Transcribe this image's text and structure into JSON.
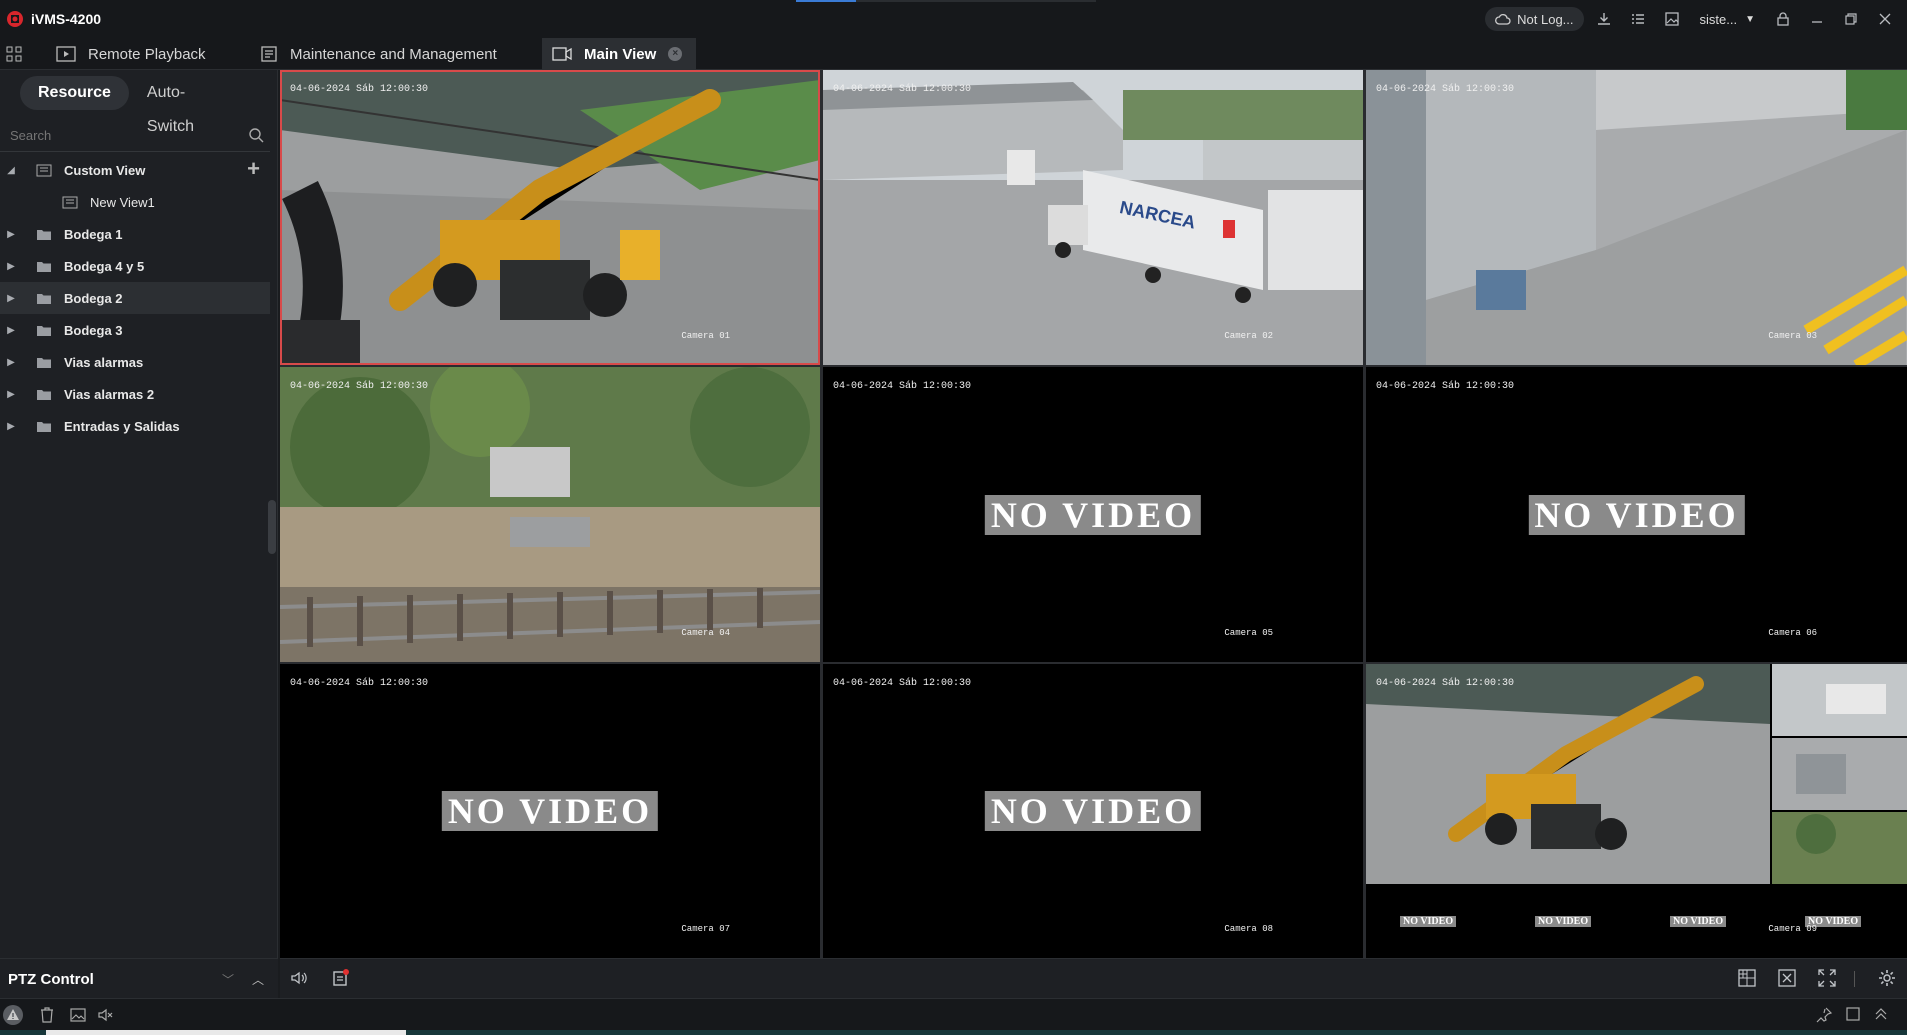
{
  "app": {
    "title": "iVMS-4200",
    "brand_color": "#d8262c"
  },
  "titlebar": {
    "cloud_status": "Not Log...",
    "user": "siste..."
  },
  "tabs": [
    {
      "label": "Remote Playback",
      "icon": "playback-icon"
    },
    {
      "label": "Maintenance and Management",
      "icon": "maintenance-icon"
    },
    {
      "label": "Main View",
      "icon": "main-view-icon",
      "active": true
    }
  ],
  "sidebar": {
    "segments": [
      "Resource",
      "Auto-Switch"
    ],
    "search_placeholder": "Search",
    "tree": [
      {
        "label": "Custom View",
        "expanded": true
      },
      {
        "label": "New View1",
        "child": true
      },
      {
        "label": "Bodega 1"
      },
      {
        "label": "Bodega 4 y 5"
      },
      {
        "label": "Bodega 2",
        "selected": true
      },
      {
        "label": "Bodega 3"
      },
      {
        "label": "Vias alarmas"
      },
      {
        "label": "Vias alarmas 2"
      },
      {
        "label": "Entradas y Salidas"
      }
    ],
    "ptz_label": "PTZ Control"
  },
  "grid": {
    "timestamps": [
      "04-06-2024 Sáb 12:00:30",
      "04-06-2024 Sáb 12:00:30",
      "04-06-2024 Sáb 12:00:30",
      "04-06-2024 Sáb 12:00:30",
      "04-06-2024 Sáb 12:00:30",
      "04-06-2024 Sáb 12:00:30",
      "04-06-2024 Sáb 12:00:30",
      "04-06-2024 Sáb 12:00:30",
      "04-06-2024 Sáb 12:00:30"
    ],
    "cameras": [
      "Camera 01",
      "Camera 02",
      "Camera 03",
      "Camera 04",
      "Camera 05",
      "Camera 06",
      "Camera 07",
      "Camera 08",
      "Camera 09"
    ],
    "no_video": "NO VIDEO",
    "truck_text": "NARCEA"
  }
}
